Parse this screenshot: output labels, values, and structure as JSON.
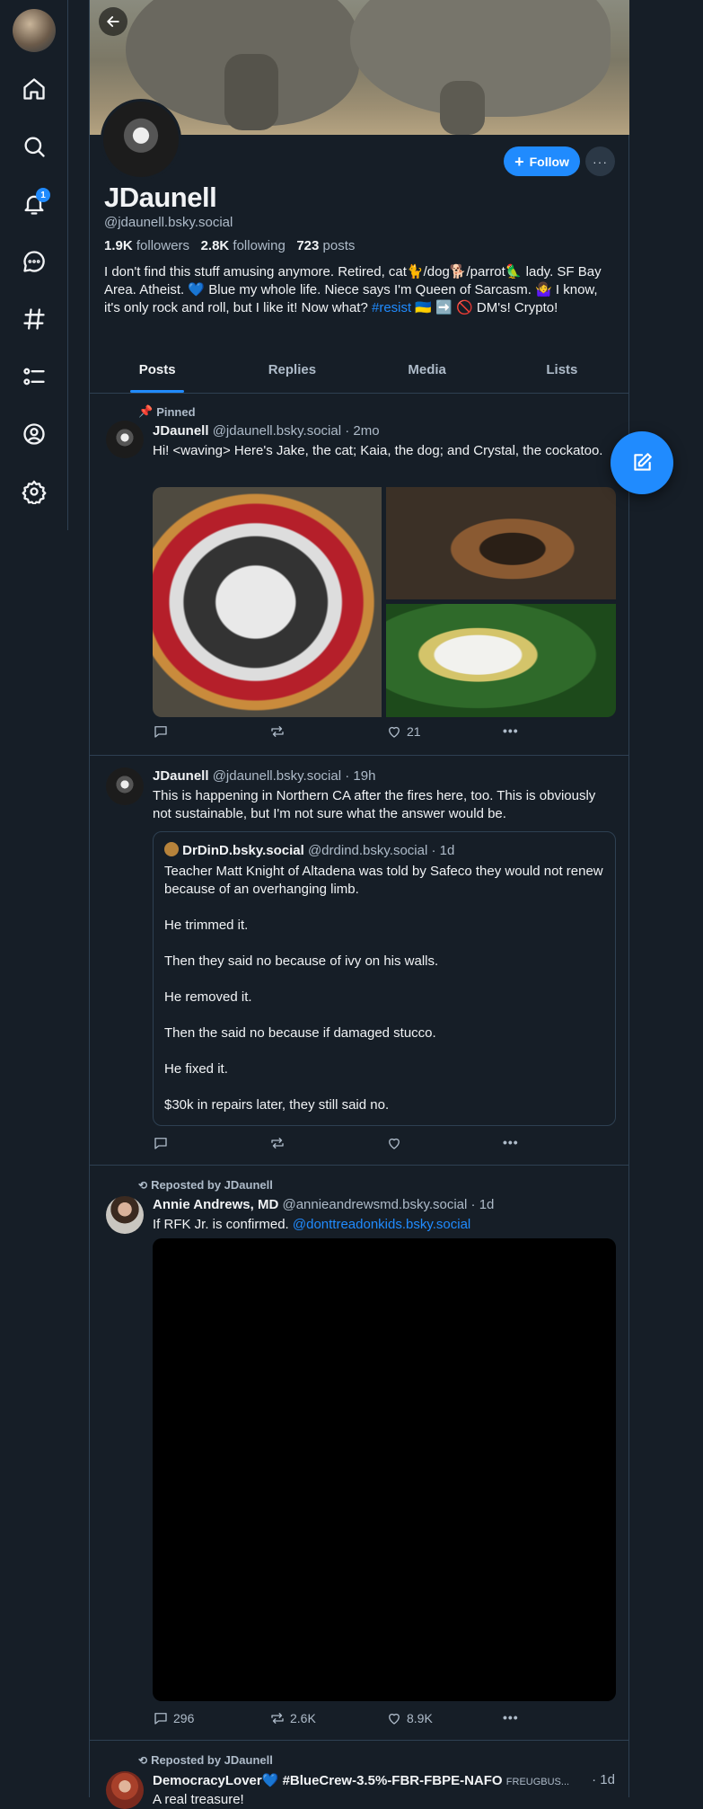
{
  "sidebar": {
    "notifications_badge": "1",
    "items": [
      "home-icon",
      "search-icon",
      "bell-icon",
      "chat-icon",
      "hashtag-icon",
      "list-icon",
      "profile-icon",
      "settings-icon"
    ]
  },
  "profile": {
    "display_name": "JDaunell",
    "handle": "@jdaunell.bsky.social",
    "follow_label": "Follow",
    "more_label": "···",
    "followers_count": "1.9K",
    "followers_label": "followers",
    "following_count": "2.8K",
    "following_label": "following",
    "posts_count": "723",
    "posts_label": "posts",
    "bio_part1": "I don't find this stuff amusing anymore. Retired, cat🐈/dog🐕/parrot🦜 lady. SF Bay Area. Atheist. 💙 Blue my whole life. Niece says I'm Queen of Sarcasm. 🤷‍♀️ I know, it's only rock and roll, but I like it! Now what? ",
    "bio_hashtag": "#resist",
    "bio_part2": " 🇺🇦 ➡️ 🚫 DM's! Crypto!"
  },
  "tabs": [
    "Posts",
    "Replies",
    "Media",
    "Lists"
  ],
  "posts": [
    {
      "context": "Pinned",
      "author": "JDaunell",
      "handle": "@jdaunell.bsky.social",
      "time": "· 2mo",
      "text": "Hi! <waving> Here's Jake, the cat; Kaia, the dog; and Crystal, the cockatoo.",
      "replies": "",
      "reposts": "",
      "likes": "21"
    },
    {
      "author": "JDaunell",
      "handle": "@jdaunell.bsky.social",
      "time": "· 19h",
      "text": "This is happening in Northern CA after the fires here, too. This is obviously not sustainable, but I'm not sure what the answer would be.",
      "quote": {
        "author": "DrDinD.bsky.social",
        "handle": "@drdind.bsky.social",
        "time": "· 1d",
        "lines": [
          "Teacher Matt Knight of Altadena was told by Safeco they would not renew because of an overhanging limb.",
          "He trimmed it.",
          "Then they said no because of ivy on his walls.",
          "He removed it.",
          "Then the said no because if damaged stucco.",
          "He fixed it.",
          "$30k in repairs later, they still said no."
        ]
      },
      "replies": "",
      "reposts": "",
      "likes": ""
    },
    {
      "context": "Reposted by JDaunell",
      "author": "Annie Andrews, MD",
      "handle": "@annieandrewsmd.bsky.social",
      "time": "· 1d",
      "text_plain": "If RFK Jr. is confirmed. ",
      "text_mention": "@donttreadonkids.bsky.social",
      "replies": "296",
      "reposts": "2.6K",
      "likes": "8.9K"
    },
    {
      "context": "Reposted by JDaunell",
      "author": "DemocracyLover💙 #BlueCrew-3.5%-FBR-FBPE-NAFO",
      "handle": "FREUGBUS...",
      "time": "· 1d",
      "text": "A real treasure!"
    }
  ],
  "colors": {
    "accent": "#208bfe",
    "background": "#161e27",
    "border": "#2e4052",
    "muted": "#aebbc9"
  }
}
